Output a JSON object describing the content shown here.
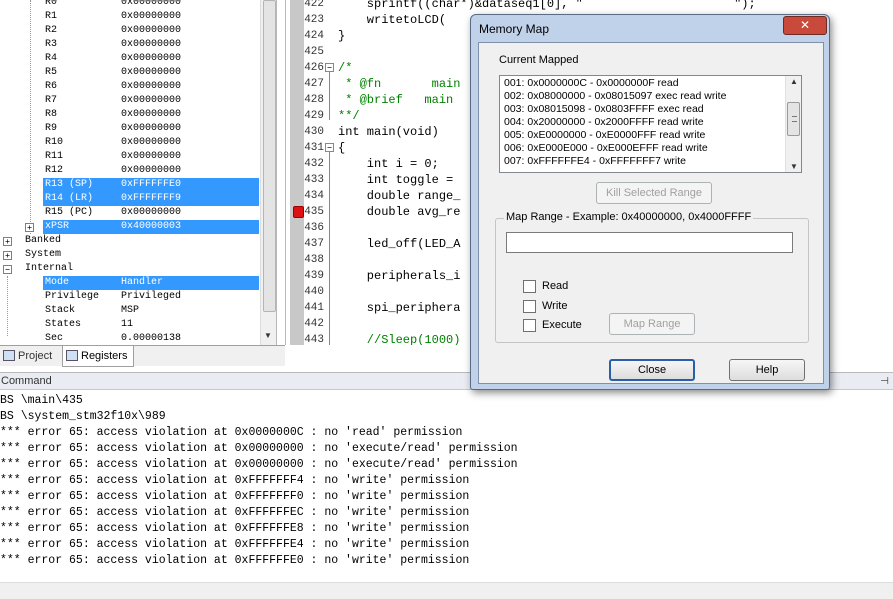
{
  "registers": {
    "rows": [
      {
        "name": "R0",
        "value": "0x00000000",
        "selected": false
      },
      {
        "name": "R1",
        "value": "0x00000000",
        "selected": false
      },
      {
        "name": "R2",
        "value": "0x00000000",
        "selected": false
      },
      {
        "name": "R3",
        "value": "0x00000000",
        "selected": false
      },
      {
        "name": "R4",
        "value": "0x00000000",
        "selected": false
      },
      {
        "name": "R5",
        "value": "0x00000000",
        "selected": false
      },
      {
        "name": "R6",
        "value": "0x00000000",
        "selected": false
      },
      {
        "name": "R7",
        "value": "0x00000000",
        "selected": false
      },
      {
        "name": "R8",
        "value": "0x00000000",
        "selected": false
      },
      {
        "name": "R9",
        "value": "0x00000000",
        "selected": false
      },
      {
        "name": "R10",
        "value": "0x00000000",
        "selected": false
      },
      {
        "name": "R11",
        "value": "0x00000000",
        "selected": false
      },
      {
        "name": "R12",
        "value": "0x00000000",
        "selected": false
      },
      {
        "name": "R13 (SP)",
        "value": "0xFFFFFFE0",
        "selected": true
      },
      {
        "name": "R14 (LR)",
        "value": "0xFFFFFFF9",
        "selected": true
      },
      {
        "name": "R15 (PC)",
        "value": "0x00000000",
        "selected": false
      },
      {
        "name": "xPSR",
        "value": "0x40000003",
        "selected": true
      }
    ],
    "groups": [
      "Banked",
      "System",
      "Internal"
    ],
    "internal": [
      {
        "name": "Mode",
        "value": "Handler",
        "selected": true
      },
      {
        "name": "Privilege",
        "value": "Privileged",
        "selected": false
      },
      {
        "name": "Stack",
        "value": "MSP",
        "selected": false
      },
      {
        "name": "States",
        "value": "11",
        "selected": false
      },
      {
        "name": "Sec",
        "value": "0.00000138",
        "selected": false
      }
    ],
    "tabs": {
      "project": "Project",
      "registers": "Registers"
    }
  },
  "editor": {
    "lines": [
      {
        "num": "422",
        "code": "    sprintf((char*)&dataseq1[0], \"                     \");",
        "fold": "",
        "comment": false
      },
      {
        "num": "423",
        "code": "    writetoLCD( ",
        "fold": "",
        "comment": false
      },
      {
        "num": "424",
        "code": "}",
        "fold": "",
        "comment": false
      },
      {
        "num": "425",
        "code": "",
        "fold": "",
        "comment": false
      },
      {
        "num": "426",
        "code": "/*",
        "fold": "−",
        "comment": true
      },
      {
        "num": "427",
        "code": " * @fn       main",
        "fold": "",
        "comment": true
      },
      {
        "num": "428",
        "code": " * @brief   main",
        "fold": "",
        "comment": true
      },
      {
        "num": "429",
        "code": "**/",
        "fold": "",
        "comment": true
      },
      {
        "num": "430",
        "code": "int main(void)",
        "fold": "",
        "comment": false
      },
      {
        "num": "431",
        "code": "{",
        "fold": "−",
        "comment": false
      },
      {
        "num": "432",
        "code": "    int i = 0;",
        "fold": "",
        "comment": false
      },
      {
        "num": "433",
        "code": "    int toggle = ",
        "fold": "",
        "comment": false
      },
      {
        "num": "434",
        "code": "    double range_",
        "fold": "",
        "comment": false
      },
      {
        "num": "435",
        "code": "    double avg_re",
        "fold": "",
        "comment": false
      },
      {
        "num": "436",
        "code": "",
        "fold": "",
        "comment": false
      },
      {
        "num": "437",
        "code": "    led_off(LED_A",
        "fold": "",
        "comment": false
      },
      {
        "num": "438",
        "code": "",
        "fold": "",
        "comment": false
      },
      {
        "num": "439",
        "code": "    peripherals_i",
        "fold": "",
        "comment": false
      },
      {
        "num": "440",
        "code": "",
        "fold": "",
        "comment": false
      },
      {
        "num": "441",
        "code": "    spi_periphera",
        "fold": "",
        "comment": false
      },
      {
        "num": "442",
        "code": "",
        "fold": "",
        "comment": false
      },
      {
        "num": "443",
        "code": "    //Sleep(1000)",
        "fold": "",
        "comment": true
      }
    ],
    "breakpoint_line": "435"
  },
  "command": {
    "title": "Command",
    "pin": "⊣",
    "lines": [
      "BS \\main\\435",
      "BS \\system_stm32f10x\\989",
      "*** error 65: access violation at 0x0000000C : no 'read' permission",
      "*** error 65: access violation at 0x00000000 : no 'execute/read' permission",
      "*** error 65: access violation at 0x00000000 : no 'execute/read' permission",
      "*** error 65: access violation at 0xFFFFFFF4 : no 'write' permission",
      "*** error 65: access violation at 0xFFFFFFF0 : no 'write' permission",
      "*** error 65: access violation at 0xFFFFFFEC : no 'write' permission",
      "*** error 65: access violation at 0xFFFFFFE8 : no 'write' permission",
      "*** error 65: access violation at 0xFFFFFFE4 : no 'write' permission",
      "*** error 65: access violation at 0xFFFFFFE0 : no 'write' permission"
    ]
  },
  "dialog": {
    "title": "Memory Map",
    "close_x": "✕",
    "current_mapped_label": "Current Mapped",
    "mapped": [
      "001:  0x0000000C - 0x0000000F  read",
      "002:  0x08000000 - 0x08015097  exec read write",
      "003:  0x08015098 - 0x0803FFFF  exec read",
      "004:  0x20000000 - 0x2000FFFF  read write",
      "005:  0xE0000000 - 0xE0000FFF  read write",
      "006:  0xE000E000 - 0xE000EFFF  read write",
      "007:  0xFFFFFFE4 - 0xFFFFFFF7  write"
    ],
    "kill_button": "Kill Selected Range",
    "map_range_label": "Map Range - Example:  0x40000000, 0x4000FFFF",
    "range_value": "",
    "read_label": "Read",
    "write_label": "Write",
    "execute_label": "Execute",
    "map_range_button": "Map Range",
    "close_button": "Close",
    "help_button": "Help"
  },
  "colors": {
    "selection": "#3399ff",
    "comment": "#008000",
    "breakpoint": "#dd1111"
  }
}
